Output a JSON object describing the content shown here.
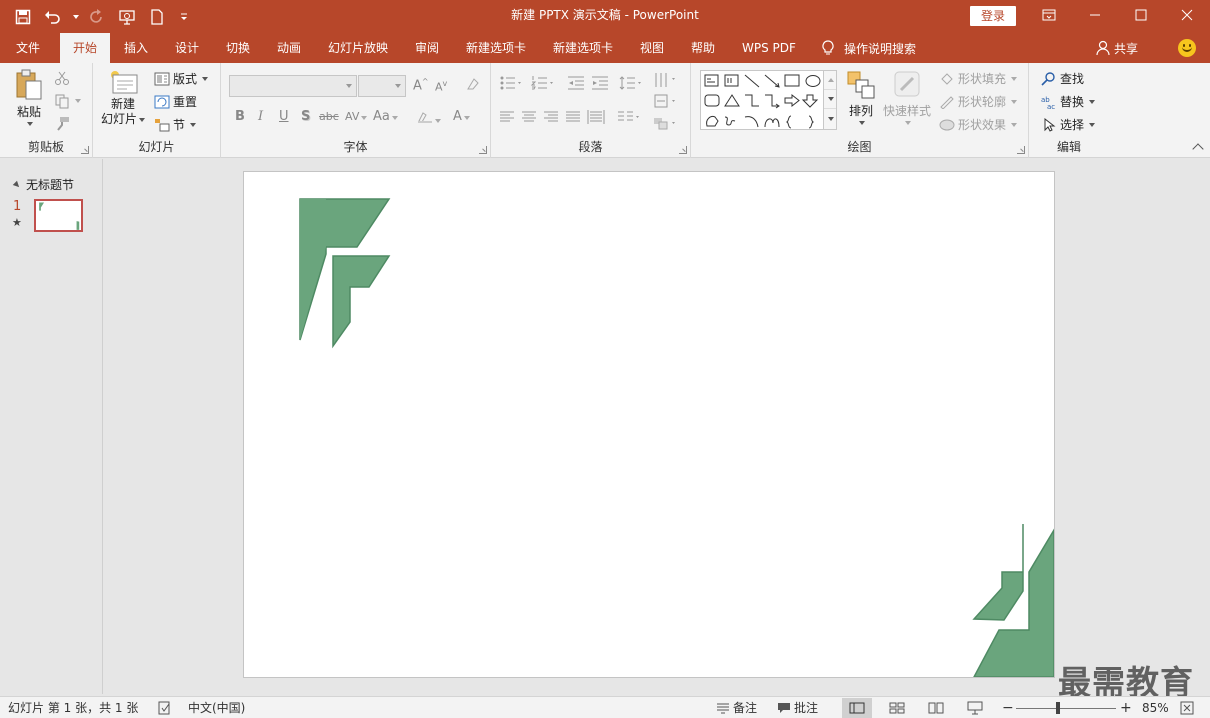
{
  "app": {
    "title": "新建 PPTX 演示文稿  -  PowerPoint",
    "login_label": "登录",
    "accent_color": "#b7472a"
  },
  "qat": {
    "icons": [
      "save-icon",
      "undo-icon",
      "redo-icon",
      "present-from-beginning-icon",
      "new-document-icon",
      "customize-qat-icon"
    ]
  },
  "tabs": [
    {
      "label": "文件"
    },
    {
      "label": "开始"
    },
    {
      "label": "插入"
    },
    {
      "label": "设计"
    },
    {
      "label": "切换"
    },
    {
      "label": "动画"
    },
    {
      "label": "幻灯片放映"
    },
    {
      "label": "审阅"
    },
    {
      "label": "新建选项卡"
    },
    {
      "label": "新建选项卡"
    },
    {
      "label": "视图"
    },
    {
      "label": "帮助"
    },
    {
      "label": "WPS PDF"
    }
  ],
  "active_tab": "开始",
  "tell_me": "操作说明搜索",
  "share_label": "共享",
  "ribbon": {
    "clipboard": {
      "label": "剪贴板",
      "paste": "粘贴"
    },
    "slides": {
      "label": "幻灯片",
      "new_slide_line1": "新建",
      "new_slide_line2": "幻灯片",
      "layout": "版式",
      "reset": "重置",
      "section": "节"
    },
    "font": {
      "label": "字体",
      "bold": "B",
      "italic": "I",
      "underline": "U",
      "shadow": "S",
      "strike": "abc",
      "spacing": "AV",
      "case": "Aa",
      "color": "A"
    },
    "paragraph": {
      "label": "段落"
    },
    "drawing": {
      "label": "绘图",
      "arrange": "排列",
      "quick_styles": "快速样式",
      "shape_fill": "形状填充",
      "shape_outline": "形状轮廓",
      "shape_effects": "形状效果"
    },
    "editing": {
      "label": "编辑",
      "find": "查找",
      "replace": "替换",
      "select": "选择"
    }
  },
  "slide_pane": {
    "section_title": "无标题节",
    "slide_number": "1",
    "star": "★"
  },
  "slide": {
    "shape_color": "#6aa57d",
    "shape_stroke": "#4e8a63"
  },
  "watermark": "最需教育",
  "status": {
    "slide_info": "幻灯片 第 1 张，共 1 张",
    "language": "中文(中国)",
    "notes": "备注",
    "comments": "批注",
    "zoom": "85%",
    "zoom_level_percent": 85
  }
}
